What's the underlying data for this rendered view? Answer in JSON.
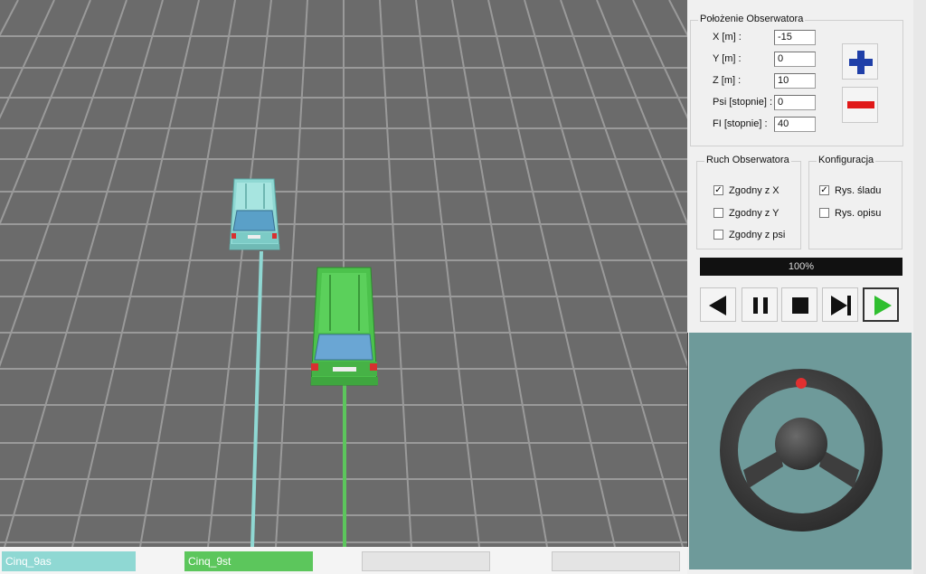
{
  "observer_position": {
    "title": "Położenie Obserwatora",
    "x_label": "X [m] :",
    "x_value": "-15",
    "y_label": "Y [m] :",
    "y_value": "0",
    "z_label": "Z [m] :",
    "z_value": "10",
    "psi_label": "Psi [stopnie] :",
    "psi_value": "0",
    "fi_label": "FI [stopnie] :",
    "fi_value": "40",
    "zoom_in_icon": "plus-icon",
    "zoom_out_icon": "minus-icon"
  },
  "observer_motion": {
    "title": "Ruch Obserwatora",
    "options": [
      {
        "label": "Zgodny z X",
        "checked": true
      },
      {
        "label": "Zgodny z Y",
        "checked": false
      },
      {
        "label": "Zgodny z psi",
        "checked": false
      }
    ]
  },
  "configuration": {
    "title": "Konfiguracja",
    "options": [
      {
        "label": "Rys. śladu",
        "checked": true
      },
      {
        "label": "Rys. opisu",
        "checked": false
      }
    ]
  },
  "progress": {
    "label": "100%",
    "fraction": 1.0
  },
  "playback": {
    "buttons": [
      "rewind-icon",
      "pause-icon",
      "stop-icon",
      "step-forward-icon",
      "play-icon"
    ]
  },
  "vehicles": [
    {
      "name": "Cinq_9as",
      "color": "#8fd8d3"
    },
    {
      "name": "Cinq_9st",
      "color": "#5cc65c"
    }
  ],
  "colors": {
    "ground": "#6b6b6b",
    "grid": "#9a9a9a",
    "wheel_background": "#6e9a9a",
    "wheel": "#4a4a4a",
    "wheel_marker": "#e03030",
    "progress_bar": "#111111"
  }
}
